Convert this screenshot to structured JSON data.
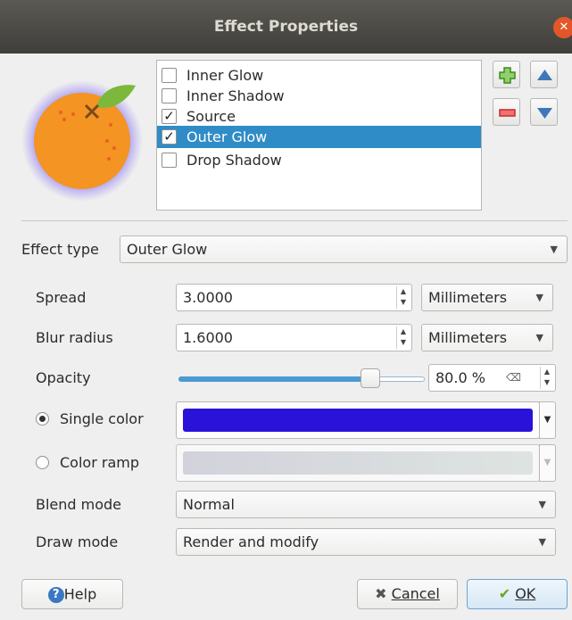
{
  "window": {
    "title": "Effect Properties"
  },
  "effects": [
    {
      "label": "Inner Glow",
      "checked": false,
      "selected": false
    },
    {
      "label": "Inner Shadow",
      "checked": false,
      "selected": false
    },
    {
      "label": "Source",
      "checked": true,
      "selected": false
    },
    {
      "label": "Outer Glow",
      "checked": true,
      "selected": true
    },
    {
      "label": "Drop Shadow",
      "checked": false,
      "selected": false
    }
  ],
  "checkmark": "✓",
  "effect_type": {
    "label": "Effect type",
    "value": "Outer Glow"
  },
  "spread": {
    "label": "Spread",
    "value": "3.0000",
    "unit": "Millimeters"
  },
  "blur_radius": {
    "label": "Blur radius",
    "value": "1.6000",
    "unit": "Millimeters"
  },
  "opacity": {
    "label": "Opacity",
    "value": "80.0 %",
    "level": 0.8
  },
  "single_color": {
    "label": "Single color",
    "selected": true,
    "color": "#2b12d9"
  },
  "color_ramp": {
    "label": "Color ramp",
    "selected": false
  },
  "blend_mode": {
    "label": "Blend mode",
    "value": "Normal"
  },
  "draw_mode": {
    "label": "Draw mode",
    "value": "Render and modify"
  },
  "buttons": {
    "help": "Help",
    "cancel": "Cancel",
    "ok": "OK"
  },
  "icons": {
    "add": "plus-icon",
    "remove": "minus-icon",
    "up": "arrow-up-icon",
    "down": "arrow-down-icon",
    "preview": "orange-preview-icon",
    "help": "question-icon",
    "cancel": "x-icon",
    "ok": "check-icon"
  },
  "colors": {
    "selection": "#308cc6",
    "accent_blue": "#2b12d9",
    "title_bar": "#4a4944"
  }
}
